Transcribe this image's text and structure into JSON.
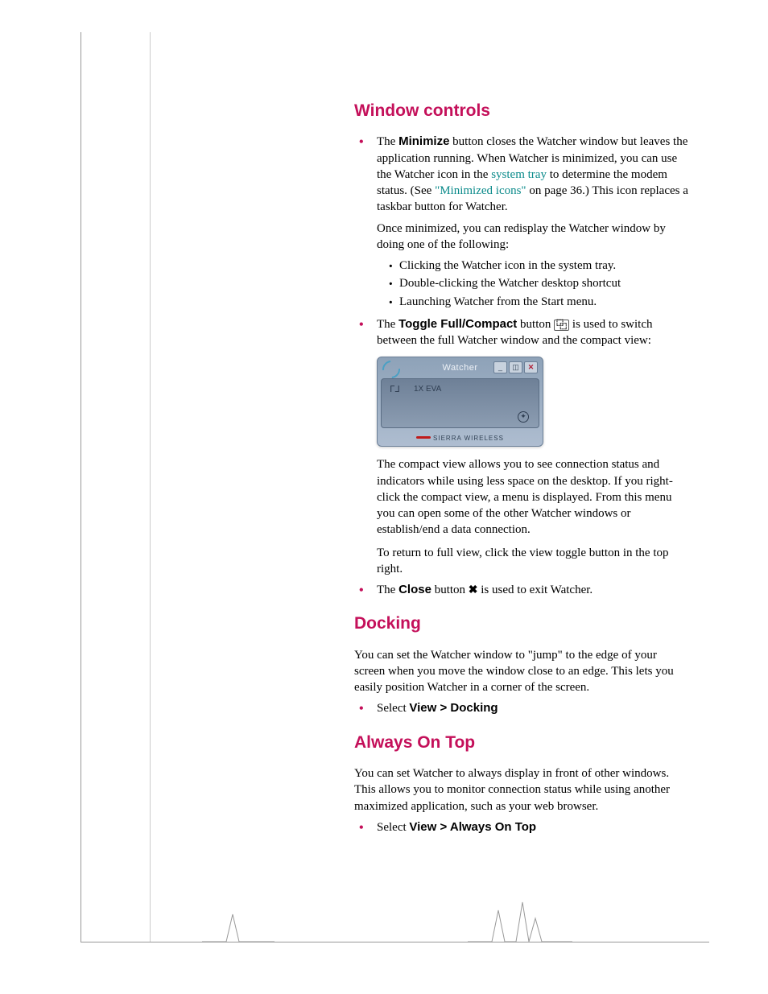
{
  "section1": {
    "heading": "Window controls",
    "bullet1_pre": "The ",
    "bullet1_bold": "Minimize",
    "bullet1_mid1": " button closes the Watcher window but leaves the application running. When Watcher is minimized, you can use the Watcher icon in the ",
    "bullet1_link1": "system tray",
    "bullet1_mid2": " to determine the modem status. (See ",
    "bullet1_link2": "\"Minimized icons\"",
    "bullet1_mid3": " on page 36.) This icon replaces a taskbar button for Watcher.",
    "para_redisplay": "Once minimized, you can redisplay the Watcher window by doing one of the following:",
    "sub1": "Clicking the Watcher icon in the system tray.",
    "sub2": "Double-clicking the Watcher desktop shortcut",
    "sub3": "Launching Watcher from the Start menu.",
    "bullet2_pre": "The ",
    "bullet2_bold": "Toggle Full/Compact",
    "bullet2_mid1": " button ",
    "bullet2_mid2": " is used to switch between the full Watcher window and the compact view:",
    "compact_para": "The compact view allows you to see connection status and indicators while using less space on the desktop. If you right-click the compact view, a menu is displayed. From this menu you can open some of the other Watcher windows or establish/end a data connection.",
    "return_para": "To return to full view, click the view toggle button in the top right.",
    "bullet3_pre": "The ",
    "bullet3_bold": "Close",
    "bullet3_mid1": " button ",
    "bullet3_mid2": " is used to exit Watcher."
  },
  "watcher": {
    "title": "Watcher",
    "mode": "1X  EVA",
    "brand": "SIERRA WIRELESS"
  },
  "section2": {
    "heading": "Docking",
    "para": "You can set the Watcher window to \"jump\" to the edge of your screen when you move the window close to an edge. This lets you easily position Watcher in a corner of the screen.",
    "bullet_pre": "Select ",
    "bullet_bold": "View > Docking"
  },
  "section3": {
    "heading": "Always On Top",
    "para": "You can set Watcher to always display in front of other windows. This allows you to monitor connection status while using another maximized application, such as your web browser.",
    "bullet_pre": "Select ",
    "bullet_bold": "View > Always On Top"
  }
}
